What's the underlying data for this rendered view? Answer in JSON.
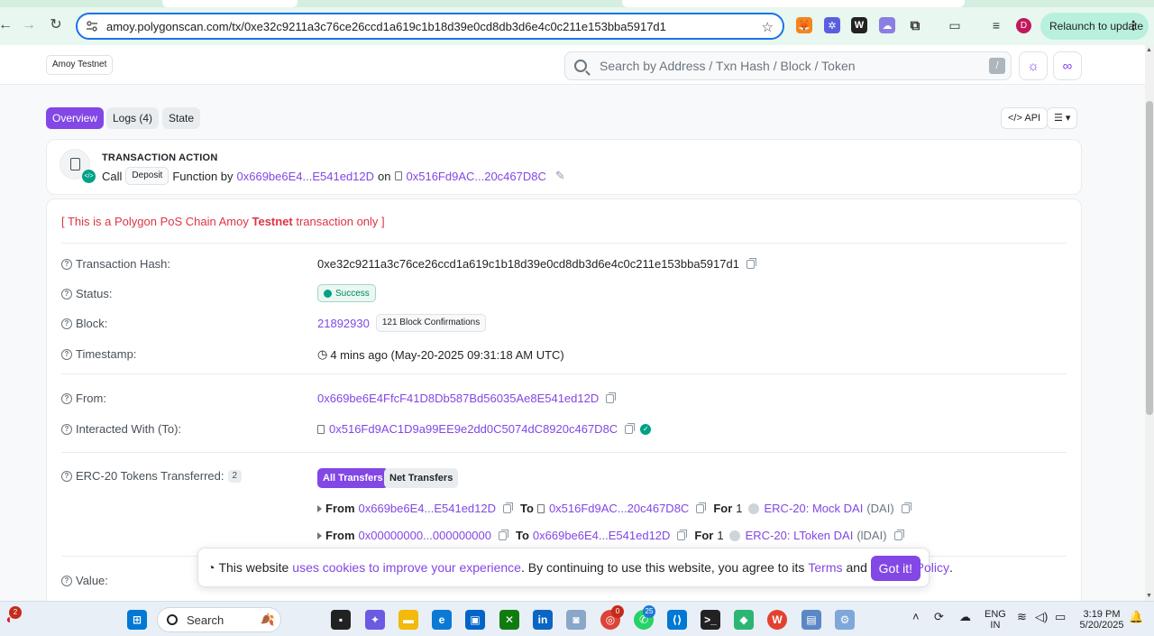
{
  "browser": {
    "url": "amoy.polygonscan.com/tx/0xe32c9211a3c76ce26ccd1a619c1b18d39e0cd8db3d6e4c0c211e153bba5917d1",
    "relaunch_label": "Relaunch to update",
    "profile_initial": "D"
  },
  "header": {
    "network_badge": "Amoy Testnet",
    "search_placeholder": "Search by Address / Txn Hash / Block / Token",
    "search_shortcut": "/"
  },
  "tabs": [
    {
      "label": "Overview",
      "active": true
    },
    {
      "label": "Logs (4)",
      "active": false
    },
    {
      "label": "State",
      "active": false
    }
  ],
  "tools": {
    "api_label": "API"
  },
  "action": {
    "title": "TRANSACTION ACTION",
    "call": "Call",
    "method": "Deposit",
    "function_by": "Function by",
    "from_short": "0x669be6E4...E541ed12D",
    "on": "on",
    "to_short": "0x516Fd9AC...20c467D8C"
  },
  "notice": {
    "prefix": "[ This is a Polygon PoS Chain Amoy ",
    "bold": "Testnet",
    "suffix": " transaction only ]"
  },
  "details": {
    "hash_label": "Transaction Hash:",
    "hash": "0xe32c9211a3c76ce26ccd1a619c1b18d39e0cd8db3d6e4c0c211e153bba5917d1",
    "status_label": "Status:",
    "status": "Success",
    "block_label": "Block:",
    "block": "21892930",
    "confirmations": "121 Block Confirmations",
    "timestamp_label": "Timestamp:",
    "timestamp": "4 mins ago (May-20-2025 09:31:18 AM UTC)",
    "from_label": "From:",
    "from": "0x669be6E4FfcF41D8Db587Bd56035Ae8E541ed12D",
    "to_label": "Interacted With (To):",
    "to": "0x516Fd9AC1D9a99EE9e2dd0C5074dC8920c467D8C",
    "erc20_label": "ERC-20 Tokens Transferred:",
    "erc20_count": "2",
    "value_label": "Value:"
  },
  "transfer_tabs": [
    "All Transfers",
    "Net Transfers"
  ],
  "transfers": [
    {
      "from_kw": "From",
      "from": "0x669be6E4...E541ed12D",
      "to_kw": "To",
      "to": "0x516Fd9AC...20c467D8C",
      "for_kw": "For",
      "amount": "1",
      "token": "ERC-20: Mock DAI",
      "symbol": "(DAI)"
    },
    {
      "from_kw": "From",
      "from": "0x00000000...000000000",
      "to_kw": "To",
      "to": "0x669be6E4...E541ed12D",
      "for_kw": "For",
      "amount": "1",
      "token": "ERC-20: LToken DAI",
      "symbol": "(lDAI)"
    }
  ],
  "cookie": {
    "text1": "This website ",
    "link1": "uses cookies to improve your experience",
    "text2": ". By continuing to use this website, you agree to its ",
    "link2": "Terms",
    "text3": " and ",
    "link3": "Privacy Policy",
    "text4": ".",
    "button": "Got it!"
  },
  "taskbar": {
    "search": "Search",
    "notif_count": "2",
    "chrome_badge": "0",
    "whatsapp_badge": "25",
    "lang1": "ENG",
    "lang2": "IN",
    "time": "3:19 PM",
    "date": "5/20/2025"
  },
  "colors": {
    "accent": "#8247e5",
    "success": "#00a186",
    "notice": "#dc3545"
  }
}
